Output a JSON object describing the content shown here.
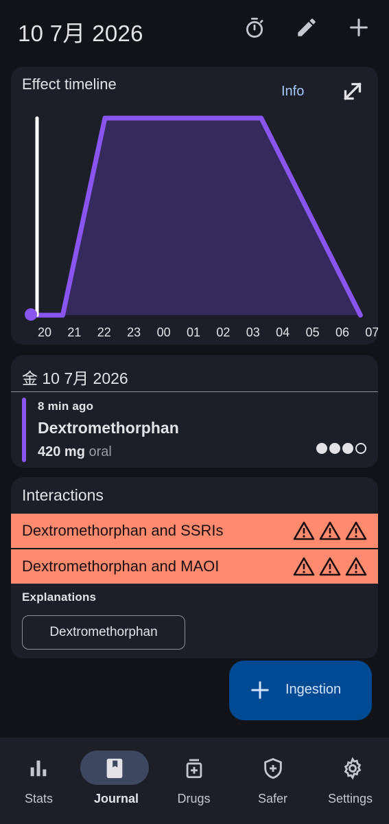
{
  "top_bar": {
    "title": "10 7月 2026",
    "icons": [
      "timer-icon",
      "pencil-icon",
      "plus-icon"
    ]
  },
  "timeline": {
    "title": "Effect timeline",
    "info_label": "Info",
    "expand_icon": "expand-icon",
    "chart_data": {
      "type": "area",
      "title": "",
      "x_ticks": [
        "20",
        "21",
        "22",
        "23",
        "00",
        "01",
        "02",
        "03",
        "04",
        "05",
        "06",
        "07"
      ],
      "series": [
        {
          "values": [
            {
              "x": "20:00",
              "y": 0
            },
            {
              "x": "21:00",
              "y": 0
            },
            {
              "x": "22:25",
              "y": 1
            },
            {
              "x": "03:40",
              "y": 1
            },
            {
              "x": "07:00",
              "y": 0
            }
          ]
        }
      ],
      "current_time_marker": "20:00",
      "colors": {
        "line": "#8a55ee",
        "fill": "#362a5c",
        "marker": "#ffffff"
      }
    }
  },
  "day": {
    "title": "金 10 7月 2026",
    "ingestions": [
      {
        "time": "8 min ago",
        "substance": "Dextromethorphan",
        "dose": "420 mg",
        "route": "oral",
        "strength_dots": 3,
        "strength_max": 4,
        "color": "#8a55ee"
      }
    ]
  },
  "interactions": {
    "title": "Interactions",
    "items": [
      {
        "label": "Dextromethorphan and SSRIs",
        "severity": 3
      },
      {
        "label": "Dextromethorphan and MAOI",
        "severity": 3
      }
    ],
    "explanations_label": "Explanations",
    "explanation_chips": [
      "Dextromethorphan"
    ],
    "row_color": "#ff8a6e"
  },
  "fab": {
    "label": "Ingestion",
    "icon": "plus-icon"
  },
  "bottom_nav": [
    {
      "label": "Stats",
      "icon": "bar-chart-icon",
      "active": false
    },
    {
      "label": "Journal",
      "icon": "book-icon",
      "active": true
    },
    {
      "label": "Drugs",
      "icon": "medicine-icon",
      "active": false
    },
    {
      "label": "Safer",
      "icon": "shield-icon",
      "active": false
    },
    {
      "label": "Settings",
      "icon": "gear-icon",
      "active": false
    }
  ]
}
